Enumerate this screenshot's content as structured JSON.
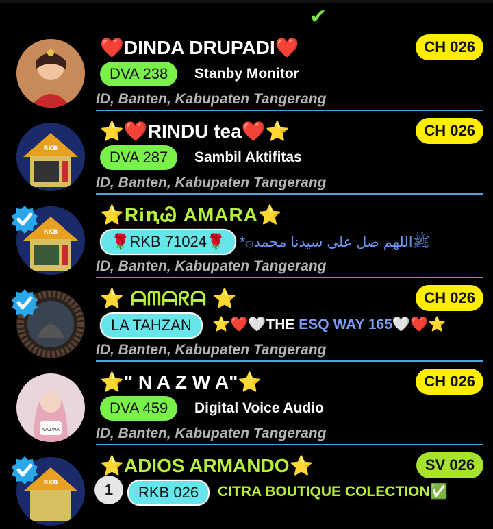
{
  "top_check_glyph": "✔",
  "rows": [
    {
      "name": "❤️DINDA DRUPADI❤️",
      "channel": "CH 026",
      "tag": "DVA 238",
      "status": "Stanby Monitor",
      "location": "ID, Banten, Kabupaten Tangerang",
      "verified": false
    },
    {
      "name": "⭐❤️RINDU tea❤️⭐",
      "channel": "CH 026",
      "tag": "DVA 287",
      "status": "Sambil Aktifitas",
      "location": "ID, Banten, Kabupaten Tangerang",
      "verified": false
    },
    {
      "name": "⭐RiꞑᏊ AMARA⭐",
      "channel": "",
      "tag": "🌹RKB 71024🌹",
      "status": "*۞ﷺاللهم صل على سيدنا محمد",
      "location": "ID, Banten, Kabupaten Tangerang",
      "verified": true
    },
    {
      "name": "⭐ ᗩᗰᗩᖇᗩ ⭐",
      "channel": "CH 026",
      "tag": "LA TAHZAN",
      "status_prefix": "⭐❤️🤍",
      "status_main": "THE",
      "status_blue": " ESQ WAY 165",
      "status_suffix": "🤍❤️⭐",
      "location": "ID, Banten, Kabupaten Tangerang",
      "verified": true
    },
    {
      "name": "⭐\" N A Z W A\"⭐",
      "channel": "CH 026",
      "tag": "DVA 459",
      "status": "Digital Voice Audio",
      "location": "ID, Banten, Kabupaten Tangerang",
      "verified": false
    },
    {
      "name": "⭐ADIOS ARMANDO⭐",
      "channel": "SV 026",
      "tag": "RKB 026",
      "status": "CITRA BOUTIQUE COLECTION✅",
      "verified": true,
      "rank": "1"
    }
  ],
  "colors": {
    "background": "#000000",
    "channel_badge": "#ffee00",
    "dva_tag": "#7af04a",
    "rkb_tag": "#66e6ea",
    "divider": "#4aa6d8",
    "verified": "#2aa7e8"
  }
}
